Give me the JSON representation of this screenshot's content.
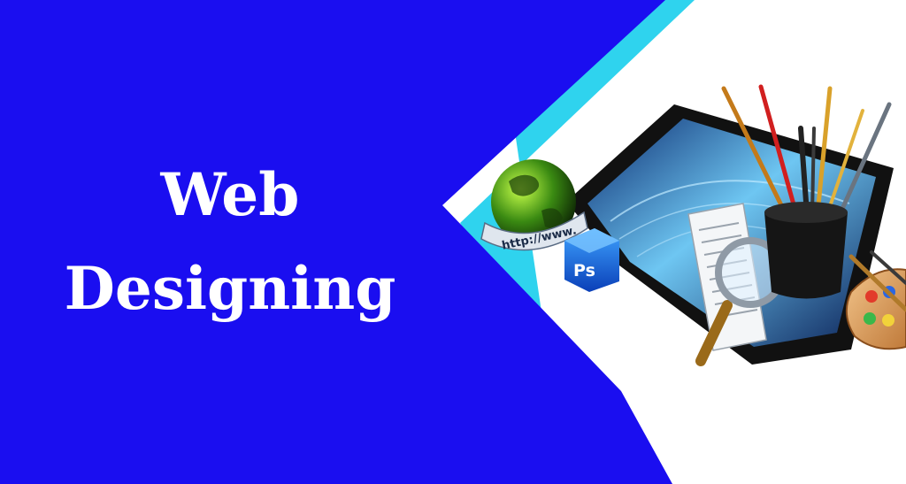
{
  "banner": {
    "headline_line1": "Web",
    "headline_line2": "Designing",
    "url_label": "http://www.",
    "ps_label": "Ps"
  },
  "colors": {
    "primary_blue": "#1a0ef0",
    "accent_cyan": "#2fd3ee",
    "background_white": "#ffffff"
  },
  "icons": [
    "globe-icon",
    "photoshop-icon",
    "document-icon",
    "magnifier-icon",
    "brush-cup-icon",
    "palette-icon",
    "tablet-icon"
  ]
}
